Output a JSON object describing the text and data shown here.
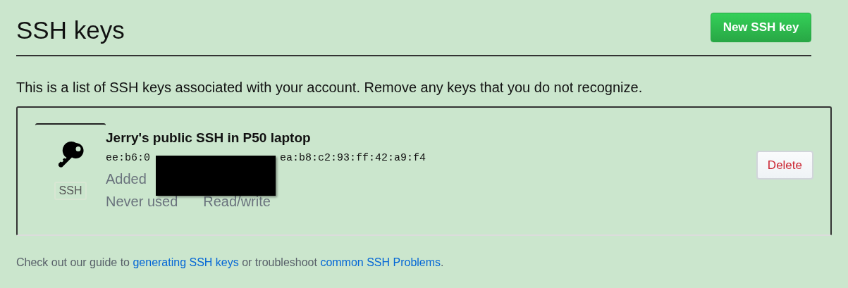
{
  "header": {
    "title": "SSH keys",
    "new_key_button": "New SSH key"
  },
  "description": "This is a list of SSH keys associated with your account. Remove any keys that you do not recognize.",
  "keys": [
    {
      "badge": "SSH",
      "title": "Jerry's public SSH in P50 laptop",
      "fingerprint_start": "ee:b6:0",
      "fingerprint_end": "ea:b8:c2:93:ff:42:a9:f4",
      "added": "Added",
      "usage": "Never used",
      "access": "Read/write",
      "redacted": true,
      "delete_button": "Delete"
    }
  ],
  "footer": [
    {
      "kind": "text",
      "text": "Check out our guide to "
    },
    {
      "kind": "link",
      "text": "generating SSH keys"
    },
    {
      "kind": "text",
      "text": " or troubleshoot "
    },
    {
      "kind": "link",
      "text": "common SSH Problems"
    },
    {
      "kind": "text",
      "text": "."
    }
  ]
}
